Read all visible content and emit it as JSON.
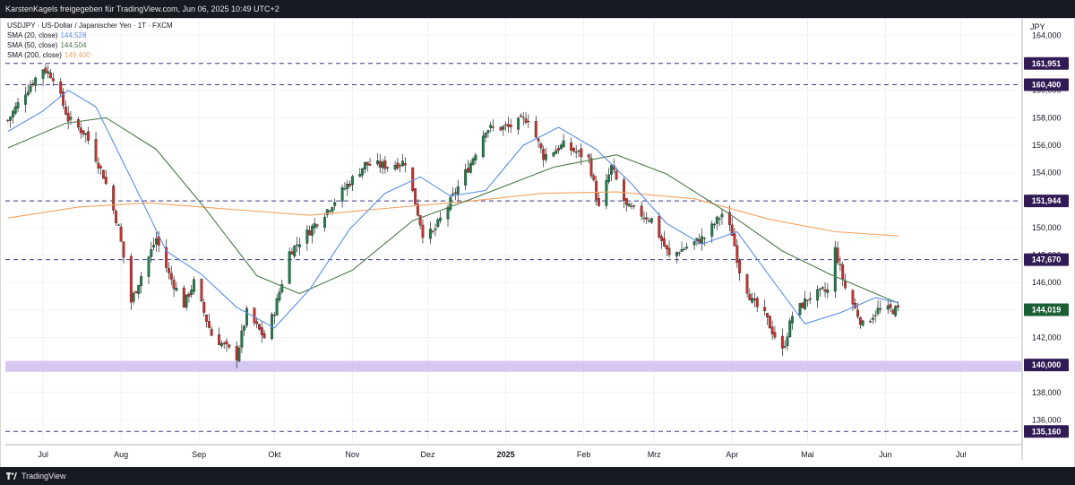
{
  "header": {
    "text": "KarstenKagels freigegeben für TradingView.com, Jun 06, 2025 10:49 UTC+2"
  },
  "legend": {
    "symbol": "USDJPY · US-Dollar / Japanischer Yen · 1T · FXCM",
    "sma20_label": "SMA (20, close)",
    "sma20_value": "144,528",
    "sma50_label": "SMA (50, close)",
    "sma50_value": "144,504",
    "sma200_label": "SMA (200, close)",
    "sma200_value": "149,400"
  },
  "footer": {
    "brand": "TradingView"
  },
  "colors": {
    "up": "#217a4a",
    "down": "#c9302c",
    "sma20": "#5b8fe6",
    "sma50": "#4d7a4d",
    "sma200": "#f4a261",
    "level_tag": "#311b55",
    "support_band": "#c9b6ee",
    "current_tag": "#1b5e35"
  },
  "chart_data": {
    "type": "candlestick",
    "currency": "JPY",
    "y_ticks": [
      "164,000",
      "162,000",
      "160,000",
      "158,000",
      "156,000",
      "154,000",
      "152,000",
      "150,000",
      "148,000",
      "146,000",
      "144,000",
      "142,000",
      "140,000",
      "138,000",
      "136,000"
    ],
    "y_tick_values": [
      164,
      162,
      160,
      158,
      156,
      154,
      152,
      150,
      148,
      146,
      144,
      142,
      140,
      138,
      136
    ],
    "ylim": [
      134.2,
      165.2
    ],
    "x_labels": [
      "Jul",
      "Aug",
      "Sep",
      "Okt",
      "Nov",
      "Dez",
      "2025",
      "Feb",
      "Mrz",
      "Apr",
      "Mai",
      "Jun",
      "Jul"
    ],
    "x_label_dates": [
      "2024-07",
      "2024-08",
      "2024-09",
      "2024-10",
      "2024-11",
      "2024-12",
      "2025-01",
      "2025-02",
      "2025-03",
      "2025-04",
      "2025-05",
      "2025-06",
      "2025-07"
    ],
    "levels": [
      {
        "label": "161,951",
        "value": 161.951
      },
      {
        "label": "160,400",
        "value": 160.4
      },
      {
        "label": "151,944",
        "value": 151.944
      },
      {
        "label": "147,670",
        "value": 147.67
      },
      {
        "label": "135,160",
        "value": 135.16
      }
    ],
    "support": {
      "label": "140,000",
      "value": 140.0,
      "low": 139.5,
      "high": 140.3
    },
    "current": {
      "label": "144,019",
      "value": 144.019
    },
    "price_path": [
      [
        "2024-06-17",
        157.8
      ],
      [
        "2024-06-24",
        159.9
      ],
      [
        "2024-07-01",
        161.6
      ],
      [
        "2024-07-05",
        161.0
      ],
      [
        "2024-07-11",
        157.9
      ],
      [
        "2024-07-18",
        156.8
      ],
      [
        "2024-07-25",
        153.8
      ],
      [
        "2024-07-31",
        150.0
      ],
      [
        "2024-08-05",
        144.6
      ],
      [
        "2024-08-09",
        146.5
      ],
      [
        "2024-08-15",
        149.2
      ],
      [
        "2024-08-20",
        146.6
      ],
      [
        "2024-08-26",
        144.4
      ],
      [
        "2024-08-30",
        146.0
      ],
      [
        "2024-09-06",
        142.2
      ],
      [
        "2024-09-16",
        140.6
      ],
      [
        "2024-09-20",
        143.8
      ],
      [
        "2024-09-27",
        142.0
      ],
      [
        "2024-10-01",
        143.9
      ],
      [
        "2024-10-07",
        148.2
      ],
      [
        "2024-10-15",
        149.8
      ],
      [
        "2024-10-22",
        151.3
      ],
      [
        "2024-10-30",
        153.1
      ],
      [
        "2024-11-06",
        154.6
      ],
      [
        "2024-11-15",
        154.5
      ],
      [
        "2024-11-22",
        154.8
      ],
      [
        "2024-11-29",
        149.6
      ],
      [
        "2024-12-03",
        149.6
      ],
      [
        "2024-12-10",
        151.9
      ],
      [
        "2024-12-18",
        154.7
      ],
      [
        "2024-12-24",
        157.2
      ],
      [
        "2025-01-02",
        157.3
      ],
      [
        "2025-01-10",
        158.0
      ],
      [
        "2025-01-16",
        155.2
      ],
      [
        "2025-01-24",
        156.0
      ],
      [
        "2025-02-03",
        155.0
      ],
      [
        "2025-02-07",
        151.4
      ],
      [
        "2025-02-12",
        154.4
      ],
      [
        "2025-02-18",
        151.5
      ],
      [
        "2025-02-28",
        150.6
      ],
      [
        "2025-03-07",
        147.9
      ],
      [
        "2025-03-14",
        148.6
      ],
      [
        "2025-03-21",
        149.3
      ],
      [
        "2025-03-28",
        151.0
      ],
      [
        "2025-04-01",
        149.6
      ],
      [
        "2025-04-04",
        146.9
      ],
      [
        "2025-04-09",
        144.6
      ],
      [
        "2025-04-14",
        143.6
      ],
      [
        "2025-04-21",
        141.0
      ],
      [
        "2025-04-25",
        143.6
      ],
      [
        "2025-05-02",
        145.0
      ],
      [
        "2025-05-09",
        145.4
      ],
      [
        "2025-05-12",
        148.4
      ],
      [
        "2025-05-16",
        145.6
      ],
      [
        "2025-05-23",
        142.9
      ],
      [
        "2025-05-29",
        144.0
      ],
      [
        "2025-06-06",
        144.019
      ]
    ],
    "sma20_path": [
      [
        "2024-06-17",
        157.0
      ],
      [
        "2024-07-01",
        158.5
      ],
      [
        "2024-07-11",
        160.0
      ],
      [
        "2024-07-22",
        158.8
      ],
      [
        "2024-08-05",
        153.6
      ],
      [
        "2024-08-19",
        148.3
      ],
      [
        "2024-09-02",
        146.6
      ],
      [
        "2024-09-16",
        144.2
      ],
      [
        "2024-10-01",
        142.7
      ],
      [
        "2024-10-15",
        145.5
      ],
      [
        "2024-10-31",
        149.9
      ],
      [
        "2024-11-14",
        152.5
      ],
      [
        "2024-11-28",
        153.7
      ],
      [
        "2024-12-10",
        152.3
      ],
      [
        "2024-12-24",
        152.7
      ],
      [
        "2025-01-08",
        156.0
      ],
      [
        "2025-01-22",
        157.3
      ],
      [
        "2025-02-06",
        155.7
      ],
      [
        "2025-02-20",
        153.2
      ],
      [
        "2025-03-06",
        150.3
      ],
      [
        "2025-03-20",
        148.8
      ],
      [
        "2025-04-03",
        149.7
      ],
      [
        "2025-04-17",
        146.2
      ],
      [
        "2025-04-30",
        143.0
      ],
      [
        "2025-05-14",
        143.8
      ],
      [
        "2025-05-28",
        144.9
      ],
      [
        "2025-06-06",
        144.528
      ]
    ],
    "sma50_path": [
      [
        "2024-06-17",
        155.8
      ],
      [
        "2024-07-10",
        157.6
      ],
      [
        "2024-07-26",
        158.0
      ],
      [
        "2024-08-15",
        155.7
      ],
      [
        "2024-09-03",
        151.5
      ],
      [
        "2024-09-24",
        146.5
      ],
      [
        "2024-10-11",
        145.2
      ],
      [
        "2024-11-01",
        146.9
      ],
      [
        "2024-11-25",
        150.5
      ],
      [
        "2024-12-20",
        152.2
      ],
      [
        "2025-01-20",
        154.4
      ],
      [
        "2025-02-14",
        155.3
      ],
      [
        "2025-03-06",
        153.9
      ],
      [
        "2025-03-31",
        151.0
      ],
      [
        "2025-04-21",
        148.3
      ],
      [
        "2025-05-10",
        146.6
      ],
      [
        "2025-06-06",
        144.504
      ]
    ],
    "sma200_path": [
      [
        "2024-06-17",
        150.7
      ],
      [
        "2024-07-15",
        151.5
      ],
      [
        "2024-08-12",
        151.8
      ],
      [
        "2024-09-16",
        151.3
      ],
      [
        "2024-10-15",
        150.9
      ],
      [
        "2024-11-14",
        151.4
      ],
      [
        "2024-12-16",
        151.9
      ],
      [
        "2025-01-16",
        152.5
      ],
      [
        "2025-02-14",
        152.6
      ],
      [
        "2025-03-17",
        152.1
      ],
      [
        "2025-04-16",
        150.6
      ],
      [
        "2025-05-12",
        149.7
      ],
      [
        "2025-06-06",
        149.4
      ]
    ]
  }
}
